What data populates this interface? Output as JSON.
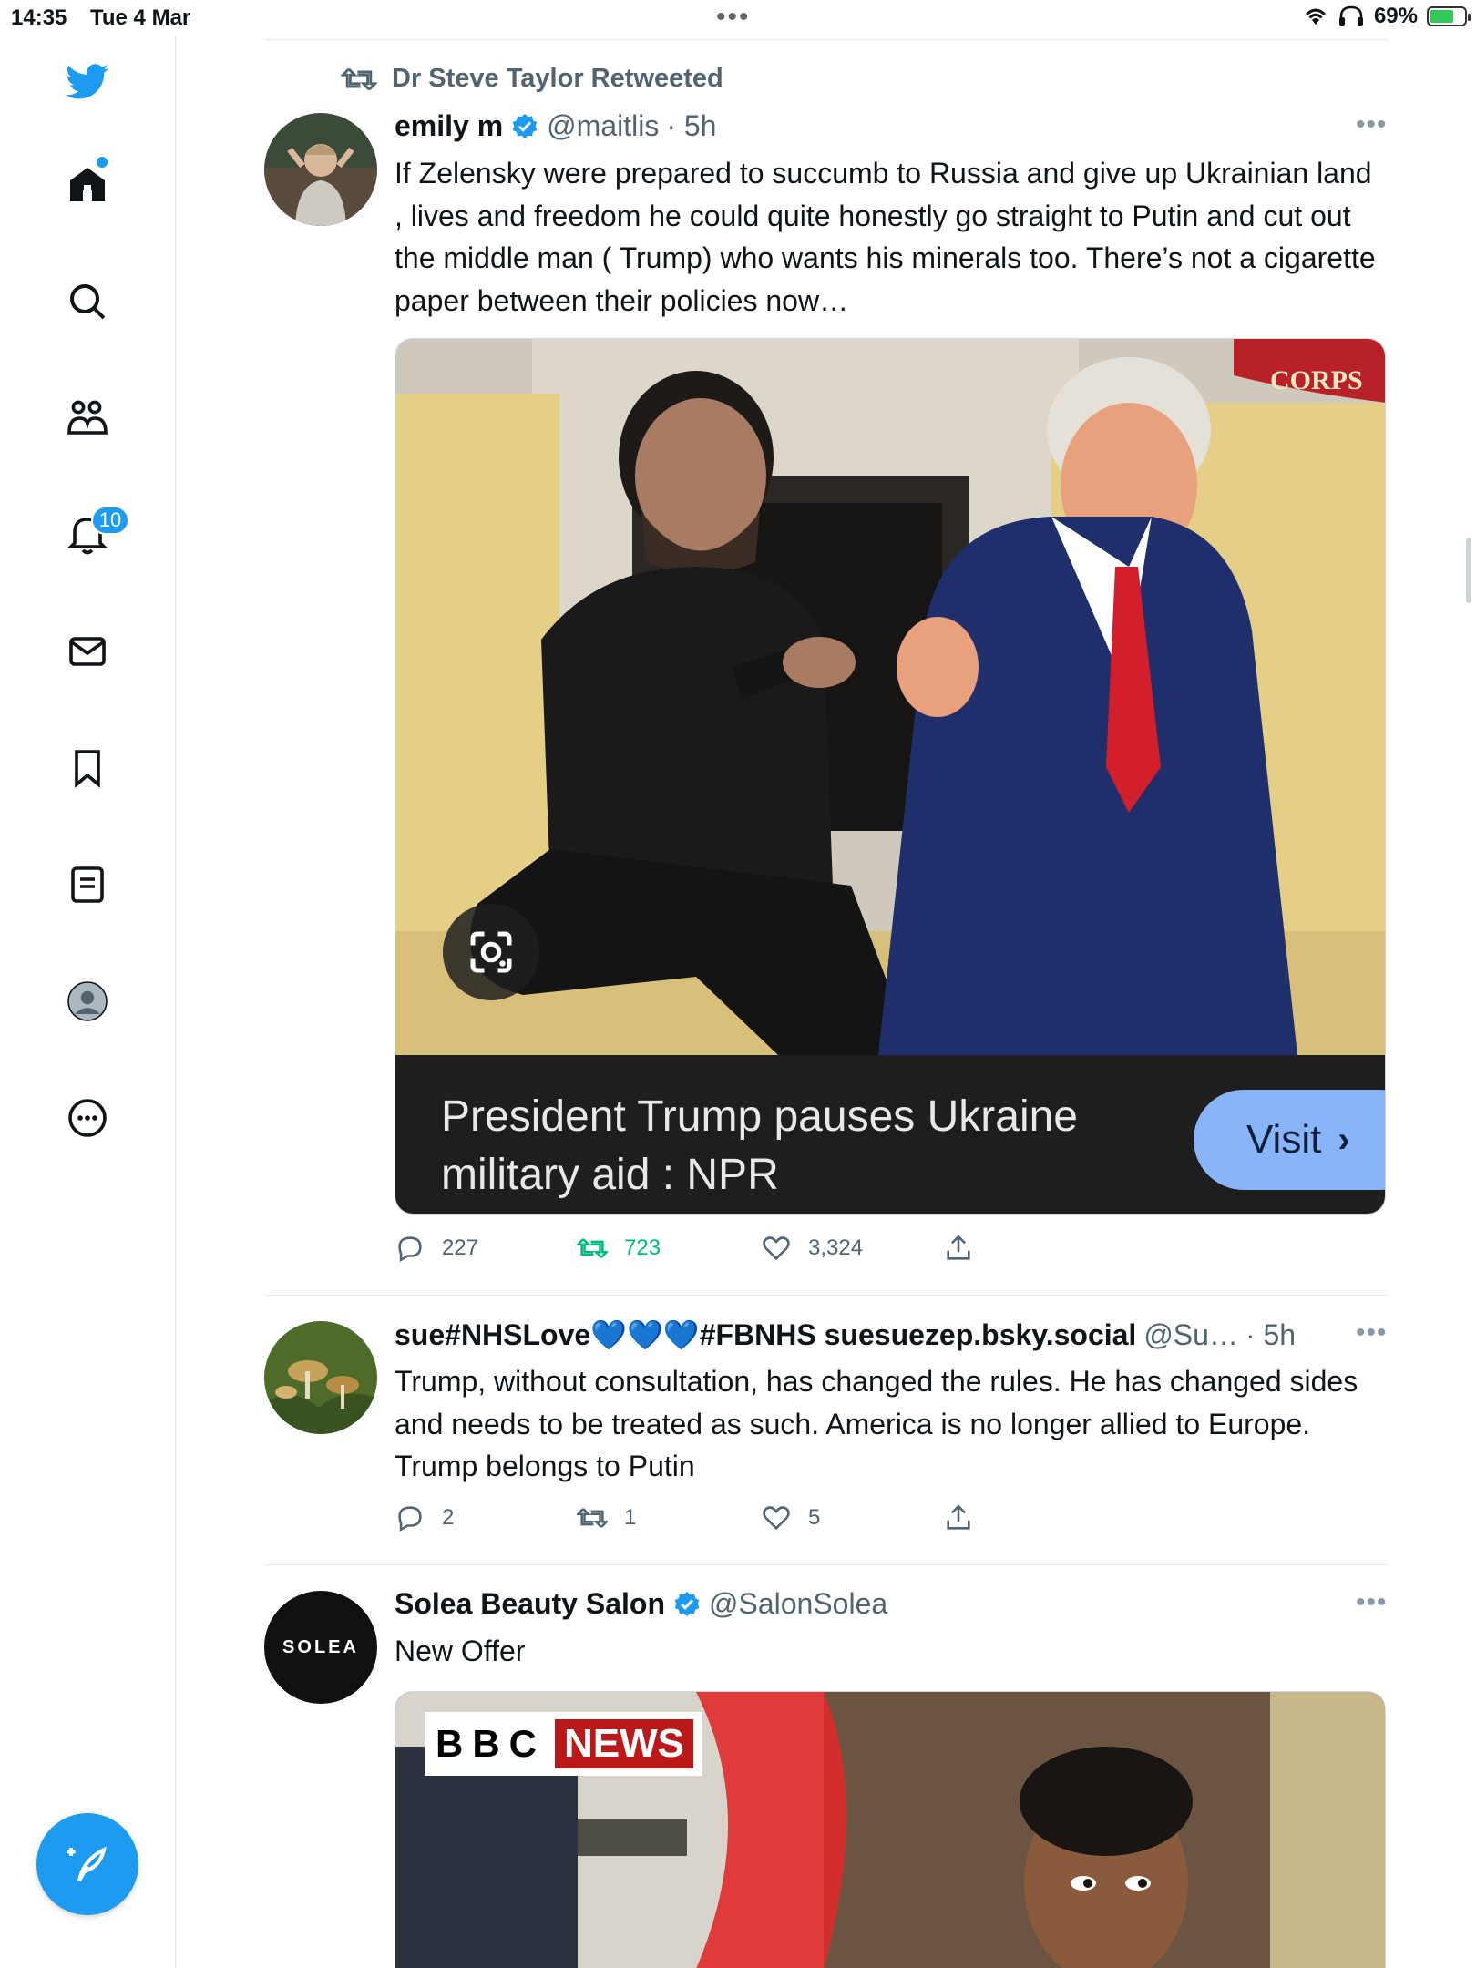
{
  "status_bar": {
    "time": "14:35",
    "date": "Tue 4 Mar",
    "battery_percent": "69%",
    "battery_level": 0.69
  },
  "sidebar": {
    "notifications_badge": "10",
    "items": [
      "home-icon",
      "search-icon",
      "communities-icon",
      "notifications-icon",
      "messages-icon",
      "bookmarks-icon",
      "lists-icon",
      "profile-icon",
      "more-icon"
    ]
  },
  "tweets": [
    {
      "retweeted_by": "Dr Steve Taylor Retweeted",
      "name": "emily m",
      "handle": "@maitlis",
      "time": "· 5h",
      "verified": true,
      "text": "If Zelensky were prepared to succumb to Russia and give up Ukrainian land , lives and freedom he could quite honestly go straight to Putin and cut out the middle man ( Trump) who wants his minerals too. There’s not a cigarette paper between their policies now…",
      "card": {
        "headline": "President Trump pauses Ukraine military aid : NPR",
        "visit_label": "Visit",
        "image_sign": "CORPS"
      },
      "replies": "227",
      "retweets": "723",
      "likes": "3,324"
    },
    {
      "name": "sue#NHSLove💙💙💙#FBNHS suesuezep.bsky.social",
      "handle": "@Su…",
      "time": "· 5h",
      "text": "Trump, without consultation, has changed the rules. He has changed sides and needs to be  treated as such.  America is no longer allied to Europe.  Trump belongs to Putin",
      "replies": "2",
      "retweets": "1",
      "likes": "5"
    },
    {
      "name": "Solea Beauty Salon",
      "handle": "@SalonSolea",
      "verified": true,
      "text": "New Offer",
      "avatar_text": "SOLEA",
      "media_logo_left": "BBC",
      "media_logo_right": "NEWS"
    }
  ],
  "colors": {
    "accent": "#1d9bf0",
    "retweet_green": "#00ba7c",
    "text_secondary": "#536471"
  }
}
